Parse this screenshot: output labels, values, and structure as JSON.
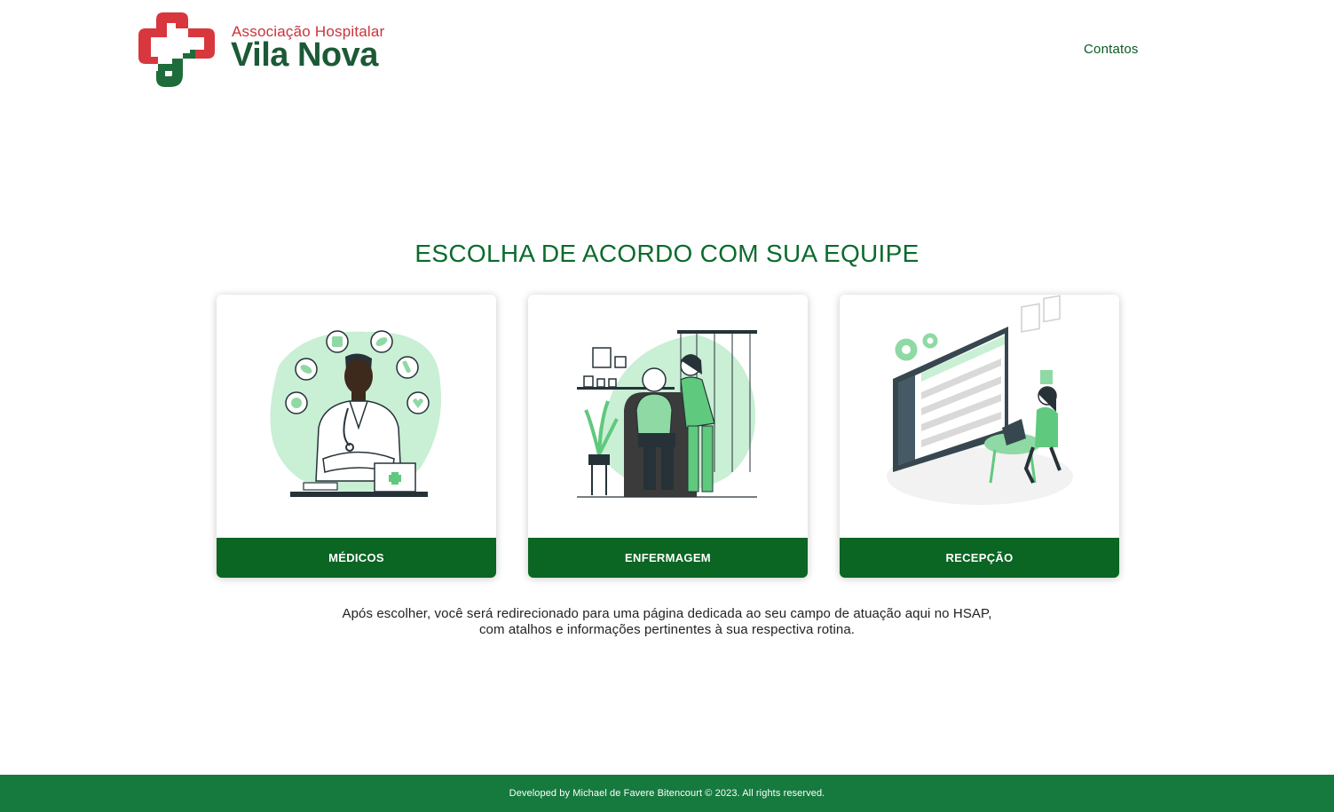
{
  "header": {
    "logo": {
      "line1": "Associação Hospitalar",
      "line2": "Vila Nova"
    },
    "nav": {
      "contacts_label": "Contatos"
    }
  },
  "main": {
    "title": "ESCOLHA DE ACORDO COM SUA EQUIPE",
    "cards": [
      {
        "label": "MÉDICOS",
        "icon": "doctor-illustration"
      },
      {
        "label": "ENFERMAGEM",
        "icon": "nurse-illustration"
      },
      {
        "label": "RECEPÇÃO",
        "icon": "reception-illustration"
      }
    ],
    "info_line1": "Após escolher, você será redirecionado para uma página dedicada ao seu campo de atuação aqui no HSAP,",
    "info_line2": "com atalhos e informações pertinentes à sua respectiva rotina."
  },
  "footer": {
    "text": "Developed by Michael de Favere Bitencourt © 2023. All rights reserved."
  },
  "colors": {
    "brand_green": "#0b6523",
    "brand_red": "#d7373d",
    "footer_green": "#167a3e",
    "title_green": "#0b6b2c",
    "illustration_mint": "#c9efd4"
  }
}
